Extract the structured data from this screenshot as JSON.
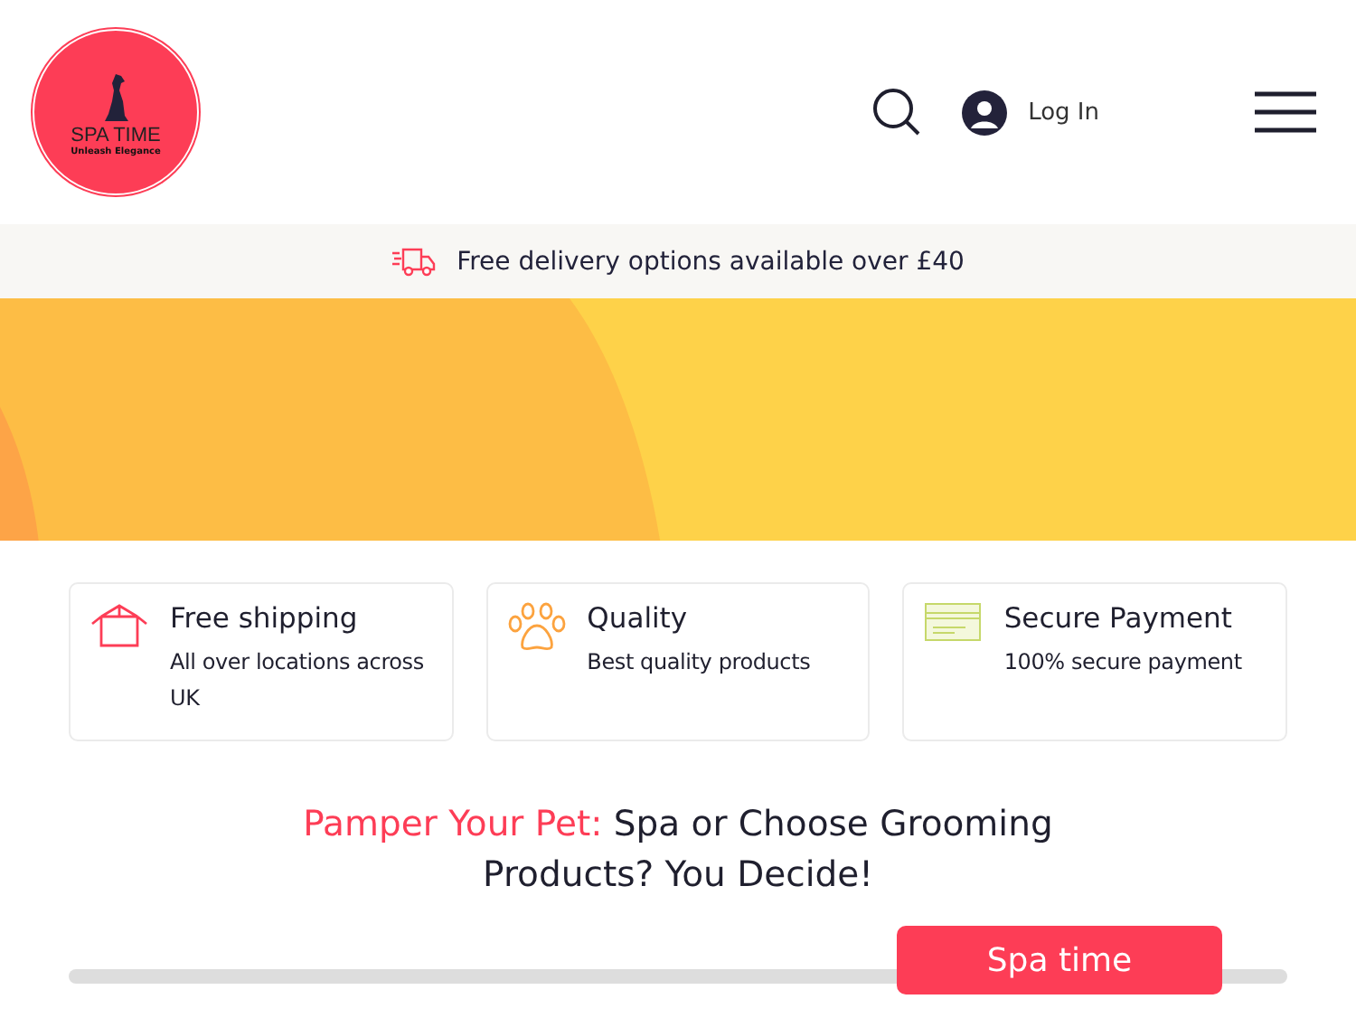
{
  "logo": {
    "title": "SPA TIME",
    "tagline": "Unleash Elegance"
  },
  "header": {
    "login": "Log In"
  },
  "banner": {
    "text": "Free delivery options available over £40"
  },
  "features": [
    {
      "kind": "box",
      "title": "Free shipping",
      "text": "All over locations across UK"
    },
    {
      "kind": "paw",
      "title": "Quality",
      "text": "Best quality products"
    },
    {
      "kind": "card",
      "title": "Secure Payment",
      "text": "100% secure payment"
    }
  ],
  "heading": {
    "highlight": "Pamper Your Pet:",
    "text": "Spa or Choose Grooming Products? You Decide!"
  },
  "tabs": [
    {
      "label": "Spa time",
      "selected": true
    }
  ]
}
